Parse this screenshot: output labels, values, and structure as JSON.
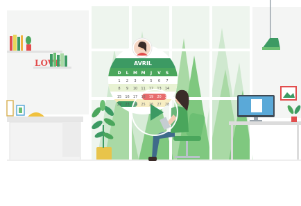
{
  "video": {
    "play_label": "Play video"
  },
  "calendar": {
    "month": "AVRIL",
    "weekdays": [
      "D",
      "L",
      "M",
      "M",
      "J",
      "V",
      "S"
    ],
    "highlighted_dates": [
      "19",
      "20",
      "21"
    ],
    "date_rows": [
      [
        "1",
        "2",
        "3",
        "4",
        "5",
        "6",
        "7"
      ],
      [
        "8",
        "9",
        "10",
        "11",
        "12",
        "13",
        "14"
      ],
      [
        "15",
        "16",
        "17",
        "18",
        "19",
        "20",
        "21"
      ],
      [
        "22",
        "23",
        "24",
        "25",
        "26",
        "27",
        "28"
      ]
    ]
  },
  "shelf": {
    "love_sign": "LOVE"
  },
  "colors": {
    "accent_green": "#3c9a63",
    "tree_green": "#6cbf73",
    "highlight_red": "#e24d4d",
    "highlight_yellow": "#e8d65a",
    "screen_blue": "#5aa9d8"
  },
  "icons": {
    "play": "play-icon"
  }
}
